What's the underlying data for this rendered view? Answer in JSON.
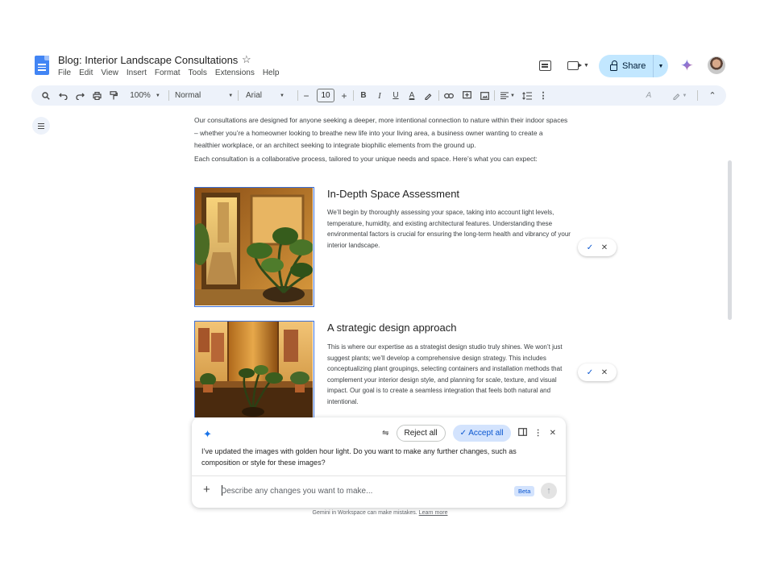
{
  "document": {
    "title": "Blog: Interior Landscape Consultations",
    "menu": [
      "File",
      "Edit",
      "View",
      "Insert",
      "Format",
      "Tools",
      "Extensions",
      "Help"
    ]
  },
  "header": {
    "share_label": "Share"
  },
  "toolbar": {
    "zoom": "100%",
    "style": "Normal",
    "font": "Arial",
    "font_size": "10"
  },
  "content": {
    "intro": "Our consultations are designed for anyone seeking a deeper, more intentional connection to nature within their indoor spaces – whether you’re a homeowner looking to breathe new life into your living area, a business owner wanting to create a healthier workplace, or an architect seeking to integrate biophilic elements from the ground up.",
    "process": "Each consultation is a collaborative process, tailored to your unique needs and space. Here’s what you can expect:",
    "sections": [
      {
        "title": "In-Depth Space Assessment",
        "body": "We’ll begin by thoroughly assessing your space, taking into account light levels, temperature, humidity, and existing architectural features. Understanding these environmental factors is crucial for ensuring the long-term health and vibrancy of your interior landscape."
      },
      {
        "title": "A strategic design approach",
        "body": "This is where our expertise as a strategist design studio truly shines. We won’t just suggest plants; we’ll develop a comprehensive design strategy. This includes conceptualizing plant groupings, selecting containers and installation methods that complement your interior design style, and planning for scale, texture, and visual impact. Our goal is to create a seamless integration that feels both natural and intentional."
      }
    ]
  },
  "gemini": {
    "reject_label": "Reject all",
    "accept_label": "Accept all",
    "message": "I’ve updated the images with golden hour light. Do you want to make any further changes, such as composition or style for these images?",
    "input_placeholder": "Describe any changes you want to make...",
    "beta_label": "Beta",
    "disclaimer": "Gemini in Workspace can make mistakes.",
    "learn_more": "Learn more"
  },
  "colors": {
    "accent": "#0b57d0",
    "share_bg": "#c2e7ff",
    "toolbar_bg": "#edf2fa",
    "image_border": "#3b6fd8"
  }
}
